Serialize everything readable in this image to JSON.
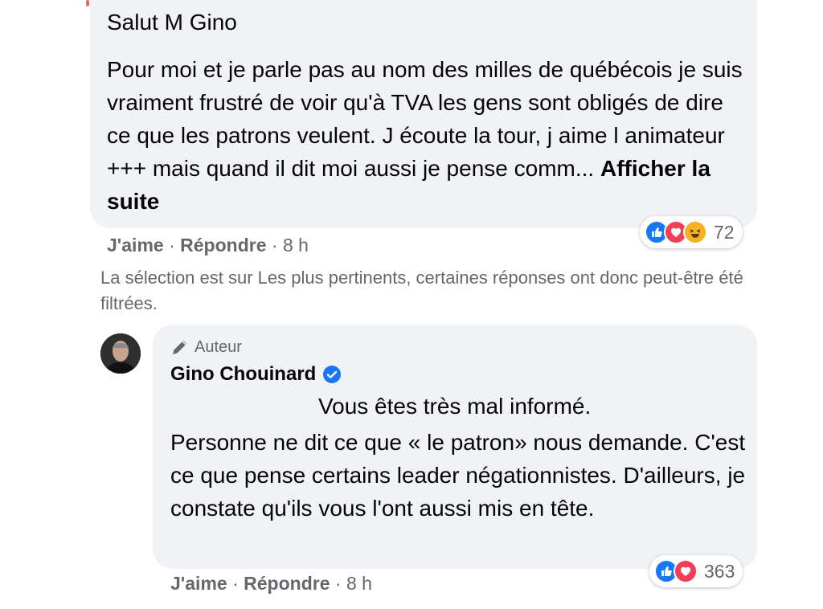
{
  "comment": {
    "greeting": "Salut M Gino",
    "body": "Pour moi et je parle pas au nom des milles de québécois je suis vraiment frustré de voir qu'à TVA les gens sont obligés de dire ce que les patrons veulent. J écoute la tour, j aime l animateur +++ mais quand il dit moi aussi je pense comm...",
    "see_more": "Afficher la suite",
    "actions": {
      "like": "J'aime",
      "separator": "·",
      "reply": "Répondre",
      "time": "8 h"
    },
    "reactions": {
      "icons": [
        "like-icon",
        "love-icon",
        "haha-icon"
      ],
      "count": "72"
    }
  },
  "filter_notice": "La sélection est sur Les plus pertinents, certaines réponses ont donc peut-être été filtrées.",
  "reply": {
    "badge": "Auteur",
    "badge_icon": "pencil-icon",
    "author": "Gino Chouinard",
    "verified_icon": "verified-badge-icon",
    "line1": "Vous êtes très mal informé.",
    "body": "Personne ne dit ce que « le patron» nous demande. C'est ce que pense certains leader négationnistes. D'ailleurs, je constate qu'ils vous l'ont aussi mis en tête.",
    "actions": {
      "like": "J'aime",
      "separator": "·",
      "reply": "Répondre",
      "time": "8 h"
    },
    "reactions": {
      "icons": [
        "like-icon",
        "love-icon"
      ],
      "count": "363"
    }
  },
  "colors": {
    "bubble": "#f0f2f5",
    "meta_text": "#65676b",
    "like": "#1877f2",
    "love": "#f33e58",
    "haha": "#f7b125",
    "verified": "#1877f2"
  }
}
